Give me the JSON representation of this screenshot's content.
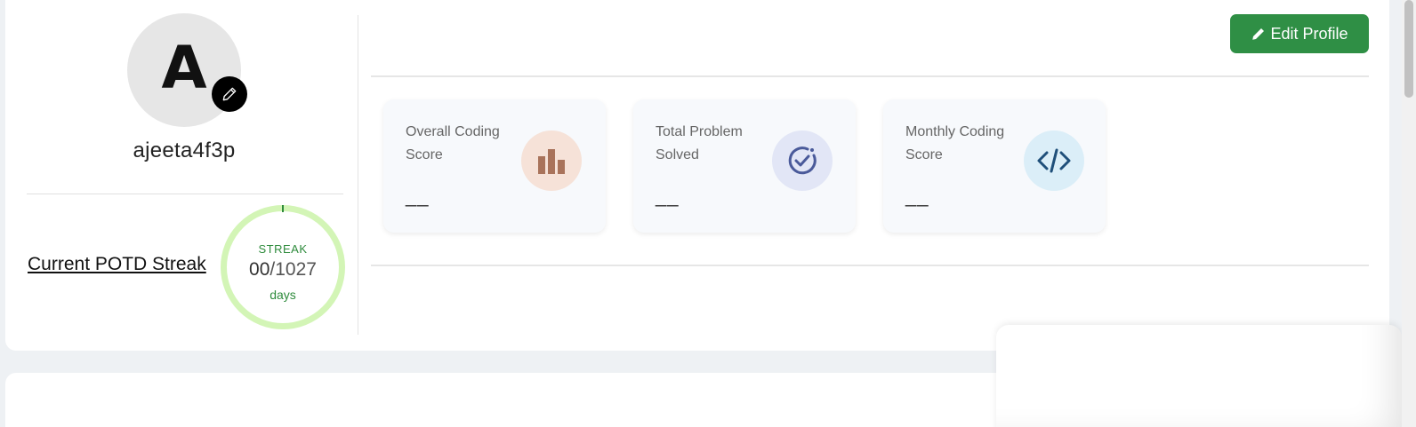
{
  "profile": {
    "avatar_letter": "A",
    "username": "ajeeta4f3p"
  },
  "streak": {
    "link_label": "Current POTD Streak",
    "title": "STREAK",
    "current": "00",
    "total": "/1027",
    "unit": "days"
  },
  "header": {
    "edit_profile_label": "Edit Profile"
  },
  "stats": [
    {
      "label": "Overall Coding Score",
      "value": "__",
      "icon": "bar-chart-icon",
      "icon_bg": "#f6e2d8",
      "icon_color": "#a9735b"
    },
    {
      "label": "Total Problem Solved",
      "value": "__",
      "icon": "check-circle-icon",
      "icon_bg": "#e2e6f6",
      "icon_color": "#4a5a9a"
    },
    {
      "label": "Monthly Coding Score",
      "value": "__",
      "icon": "code-icon",
      "icon_bg": "#dbeef8",
      "icon_color": "#1f4f7a"
    }
  ],
  "colors": {
    "brand_green": "#2f8f45",
    "streak_ring": "#d3f5b6"
  }
}
